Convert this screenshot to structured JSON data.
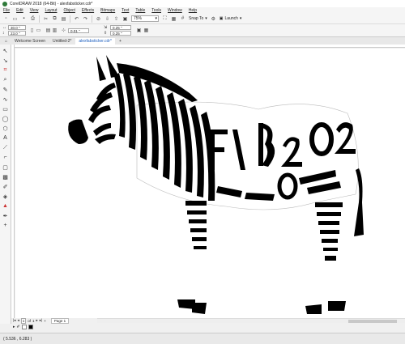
{
  "window": {
    "title": "CorelDRAW 2018 (64-Bit) - alexfabsticker.cdr*"
  },
  "menu": [
    "File",
    "Edit",
    "View",
    "Layout",
    "Object",
    "Effects",
    "Bitmaps",
    "Text",
    "Table",
    "Tools",
    "Window",
    "Help"
  ],
  "toolbar": {
    "zoom": "75%",
    "snap_label": "Snap To",
    "launch_label": "Launch"
  },
  "properties": {
    "width": "30.0 \"",
    "height": "23.0 \"",
    "nudge": "0.01 \"",
    "dup_x": "0.25 \"",
    "dup_y": "0.25 \""
  },
  "tabs": [
    "Welcome Screen",
    "Untitled-2*",
    "alexfabsticker.cdr*"
  ],
  "artwork": {
    "lettering": [
      "FAB",
      "2020",
      "20",
      "20"
    ]
  },
  "pagebar": {
    "current": "1",
    "of_label": "of",
    "total": "1",
    "page_tab": "Page 1"
  },
  "status": {
    "coordinates": "( 5.536 , 6.283 )"
  }
}
